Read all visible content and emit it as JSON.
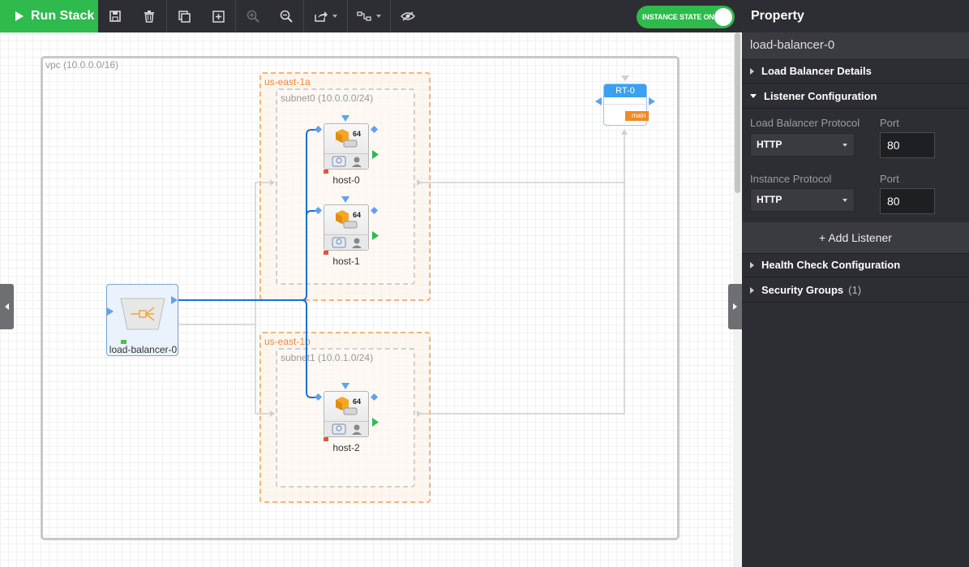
{
  "toolbar": {
    "run_label": "Run Stack",
    "instance_state_label": "INSTANCE STATE ON",
    "instance_state_on": true
  },
  "canvas": {
    "vpc_label": "vpc (10.0.0.0/16)",
    "zones": [
      {
        "label": "us-east-1a",
        "subnet_label": "subnet0 (10.0.0.0/24)"
      },
      {
        "label": "us-east-1b",
        "subnet_label": "subnet1 (10.0.1.0/24)"
      }
    ],
    "instances": [
      {
        "name": "host-0",
        "arch": "64"
      },
      {
        "name": "host-1",
        "arch": "64"
      },
      {
        "name": "host-2",
        "arch": "64"
      }
    ],
    "load_balancer": {
      "name": "load-balancer-0"
    },
    "route_table": {
      "name": "RT-0",
      "tag": "main"
    }
  },
  "panel": {
    "title": "Property",
    "resource_name": "load-balancer-0",
    "sections": {
      "details": "Load Balancer Details",
      "listener": "Listener Configuration",
      "health": "Health Check Configuration",
      "security": "Security Groups",
      "security_count": "(1)"
    },
    "listener": {
      "lb_protocol_label": "Load Balancer Protocol",
      "lb_protocol_value": "HTTP",
      "lb_port_label": "Port",
      "lb_port_value": "80",
      "instance_protocol_label": "Instance Protocol",
      "instance_protocol_value": "HTTP",
      "instance_port_label": "Port",
      "instance_port_value": "80",
      "add_label": "+ Add Listener"
    }
  },
  "colors": {
    "accent_green": "#2fba4d",
    "toolbar_bg": "#2d2e33",
    "az_border": "#f3b47a",
    "connection_blue": "#1e6fd0",
    "route_blue": "#3ba0f2"
  }
}
